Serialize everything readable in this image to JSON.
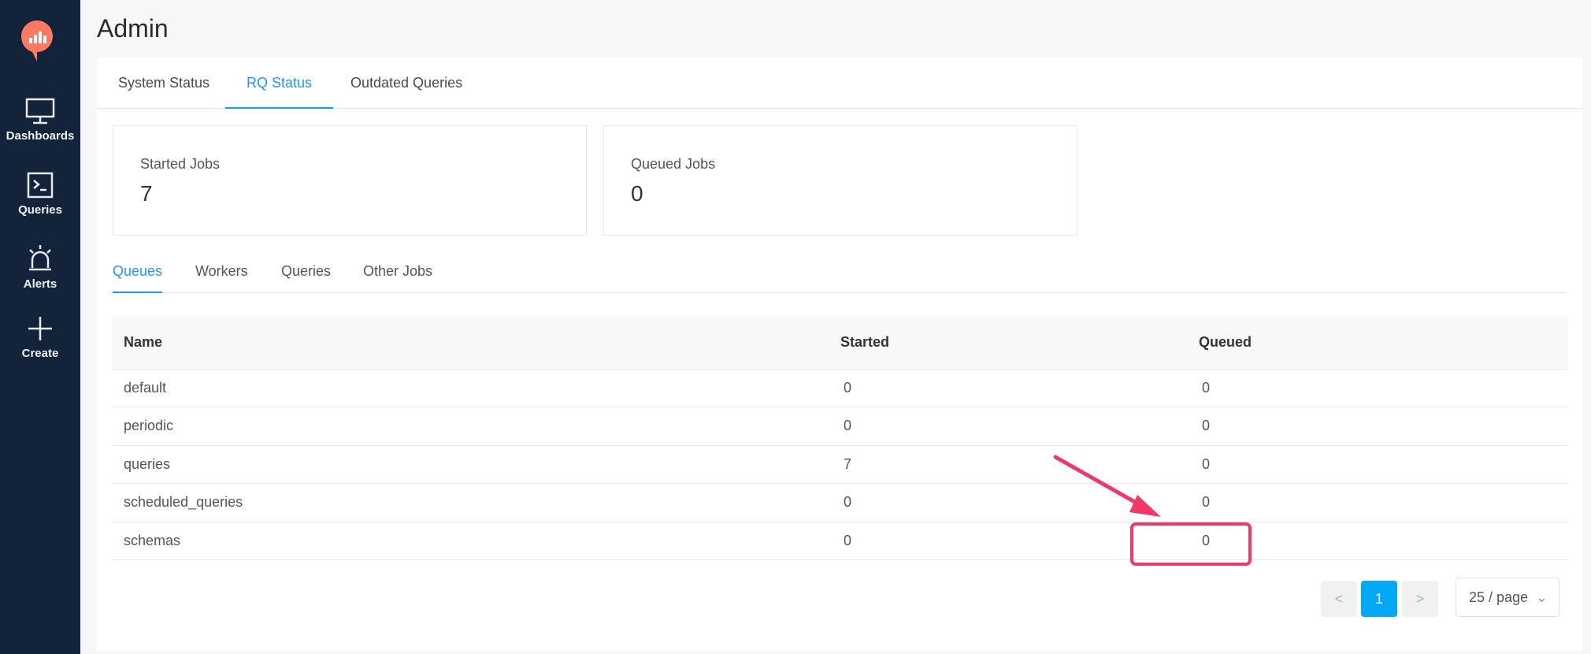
{
  "sidebar": {
    "items": [
      {
        "label": "Dashboards",
        "icon": "monitor-icon"
      },
      {
        "label": "Queries",
        "icon": "terminal-icon"
      },
      {
        "label": "Alerts",
        "icon": "alarm-icon"
      },
      {
        "label": "Create",
        "icon": "plus-icon"
      }
    ]
  },
  "page": {
    "title": "Admin"
  },
  "top_tabs": [
    "System Status",
    "RQ Status",
    "Outdated Queries"
  ],
  "stats": [
    {
      "title": "Started Jobs",
      "value": "7"
    },
    {
      "title": "Queued Jobs",
      "value": "0"
    }
  ],
  "sub_tabs": [
    "Queues",
    "Workers",
    "Queries",
    "Other Jobs"
  ],
  "table": {
    "headers": [
      "Name",
      "Started",
      "Queued"
    ],
    "rows": [
      [
        "default",
        "0",
        "0"
      ],
      [
        "periodic",
        "0",
        "0"
      ],
      [
        "queries",
        "7",
        "0"
      ],
      [
        "scheduled_queries",
        "0",
        "0"
      ],
      [
        "schemas",
        "0",
        "0"
      ]
    ]
  },
  "pagination": {
    "prev": "<",
    "current": "1",
    "next": ">",
    "page_size": "25 / page"
  },
  "colors": {
    "sidebar": "#13233a",
    "accent": "#2196f3",
    "annotation": "#f0386b",
    "logo": "#ff7964"
  }
}
